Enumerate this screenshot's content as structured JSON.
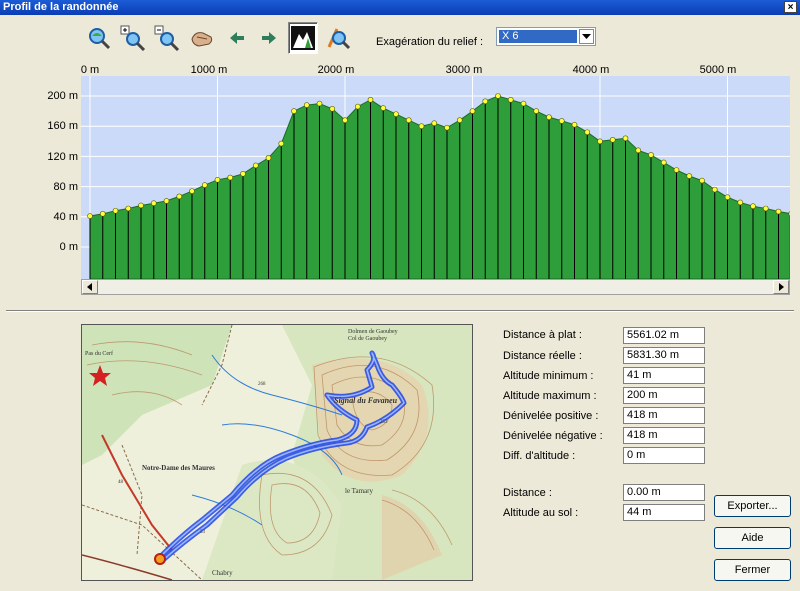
{
  "window": {
    "title": "Profil de la randonnée",
    "close_glyph": "×"
  },
  "toolbar": {
    "tools": [
      {
        "name": "zoom-fit-icon"
      },
      {
        "name": "zoom-in-icon"
      },
      {
        "name": "zoom-out-icon"
      },
      {
        "name": "pan-hand-icon"
      },
      {
        "name": "arrow-left-icon"
      },
      {
        "name": "arrow-right-icon"
      },
      {
        "name": "relief-profile-icon",
        "active": true
      },
      {
        "name": "route-search-icon"
      }
    ],
    "exaggeration_label": "Exagération du relief :",
    "exaggeration_value": "X 6"
  },
  "chart_data": {
    "type": "area",
    "x_unit": "m",
    "y_unit": "m",
    "x_ticks": [
      "0 m",
      "1000 m",
      "2000 m",
      "3000 m",
      "4000 m",
      "5000 m"
    ],
    "y_ticks": [
      "200 m",
      "160 m",
      "120 m",
      "80 m",
      "40 m",
      "0 m"
    ],
    "xlim": [
      0,
      5561
    ],
    "ylim": [
      -40,
      220
    ],
    "grid": true,
    "fill_color": "#2E9E3A",
    "background_color": "#CADAF8",
    "line_color": "#000000",
    "marker_color": "#FFFF40",
    "x": [
      0,
      100,
      200,
      300,
      400,
      500,
      600,
      700,
      800,
      900,
      1000,
      1100,
      1200,
      1300,
      1400,
      1500,
      1600,
      1700,
      1800,
      1900,
      2000,
      2100,
      2200,
      2300,
      2400,
      2500,
      2600,
      2700,
      2800,
      2900,
      3000,
      3100,
      3200,
      3300,
      3400,
      3500,
      3600,
      3700,
      3800,
      3900,
      4000,
      4100,
      4200,
      4300,
      4400,
      4500,
      4600,
      4700,
      4800,
      4900,
      5000,
      5100,
      5200,
      5300,
      5400,
      5500,
      5561
    ],
    "y": [
      41,
      44,
      48,
      51,
      55,
      58,
      61,
      67,
      74,
      82,
      89,
      92,
      97,
      108,
      118,
      137,
      180,
      188,
      190,
      183,
      168,
      186,
      195,
      184,
      176,
      168,
      160,
      164,
      158,
      168,
      180,
      193,
      200,
      195,
      190,
      180,
      172,
      167,
      162,
      152,
      140,
      142,
      144,
      128,
      122,
      112,
      102,
      94,
      88,
      76,
      66,
      59,
      54,
      51,
      47,
      44,
      44
    ]
  },
  "stats": [
    {
      "label": "Distance à plat :",
      "value": "5561.02 m"
    },
    {
      "label": "Distance réelle :",
      "value": "5831.30 m"
    },
    {
      "label": "Altitude minimum :",
      "value": "41 m"
    },
    {
      "label": "Altitude maximum :",
      "value": "200 m"
    },
    {
      "label": "Dénivelée positive :",
      "value": "418 m"
    },
    {
      "label": "Dénivelée négative :",
      "value": "418 m"
    },
    {
      "label": "Diff. d'altitude :",
      "value": "0 m"
    }
  ],
  "cursor": [
    {
      "label": "Distance :",
      "value": "0.00 m"
    },
    {
      "label": "Altitude au sol :",
      "value": "44 m"
    }
  ],
  "buttons": {
    "export": "Exporter...",
    "help": "Aide",
    "close": "Fermer"
  },
  "map": {
    "labels": [
      "Dolmen de Gaoubey",
      "Col de Gaoubey",
      "Signal du Favaneu",
      "Pas du Cerf",
      "Notre-Dame des Maures",
      "le Tamary",
      "Chabry"
    ],
    "spot_heights": [
      "268",
      "253",
      "53",
      "48"
    ],
    "track_color": "#1E46E6"
  }
}
